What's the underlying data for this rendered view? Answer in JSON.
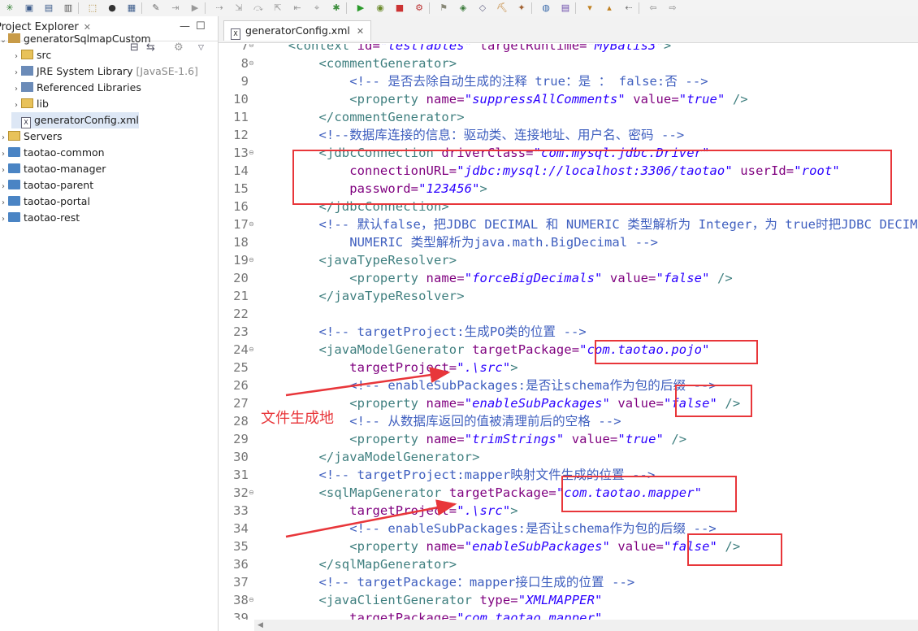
{
  "toolbar": {
    "icons": [
      "new-icon",
      "save-icon",
      "save-all-icon",
      "print-icon",
      "build-icon",
      "user-icon",
      "debug-toggle-icon",
      "pin-icon",
      "skip-icon",
      "run-last-icon",
      "step-icon",
      "step-into-icon",
      "step-over-icon",
      "step-return-icon",
      "drop-frame-icon",
      "use-step-filters-icon",
      "debug-icon",
      "run-icon",
      "coverage-icon",
      "stop-icon",
      "external-tools-icon",
      "new-server-icon",
      "new-class-icon",
      "open-type-icon",
      "open-task-icon",
      "search-icon",
      "globe-icon",
      "tasks-icon",
      "next-annotation-icon",
      "prev-annotation-icon",
      "last-edit-icon",
      "back-icon",
      "forward-icon"
    ]
  },
  "explorer": {
    "title": "Project Explorer",
    "close_glyph": "✕",
    "minimize_glyph": "—",
    "maximize_glyph": "☐",
    "tree": [
      {
        "name": "generatorSqlmapCustom",
        "arrow": "⌄",
        "icon": "project-icon"
      },
      {
        "name": "src",
        "arrow": "›",
        "icon": "package-folder-icon"
      },
      {
        "name": "JRE System Library",
        "suffix": "[JavaSE-1.6]",
        "arrow": "›",
        "icon": "library-icon"
      },
      {
        "name": "Referenced Libraries",
        "arrow": "›",
        "icon": "library-icon"
      },
      {
        "name": "lib",
        "arrow": "›",
        "icon": "folder-icon"
      },
      {
        "name": "generatorConfig.xml",
        "arrow": "",
        "icon": "xml-file-icon"
      },
      {
        "name": "Servers",
        "arrow": "›",
        "icon": "folder-icon"
      },
      {
        "name": "taotao-common",
        "arrow": "›",
        "icon": "project-folder-icon"
      },
      {
        "name": "taotao-manager",
        "arrow": "›",
        "icon": "project-folder-icon"
      },
      {
        "name": "taotao-parent",
        "arrow": "›",
        "icon": "project-folder-icon"
      },
      {
        "name": "taotao-portal",
        "arrow": "›",
        "icon": "project-folder-icon"
      },
      {
        "name": "taotao-rest",
        "arrow": "›",
        "icon": "project-folder-icon"
      }
    ]
  },
  "editor": {
    "tab_label": "generatorConfig.xml",
    "tab_close": "✕",
    "xml_icon_letter": "X",
    "fold_glyph": "⊖",
    "lines": [
      {
        "n": "7",
        "fold": true,
        "t": [
          [
            "    ",
            ""
          ],
          [
            "<context ",
            "tag"
          ],
          [
            "id=",
            "attr"
          ],
          [
            "\"testTables\"",
            "val"
          ],
          [
            " targetRuntime=",
            "attr"
          ],
          [
            "\"MyBatis3\"",
            "val"
          ],
          [
            ">",
            "tag"
          ]
        ]
      },
      {
        "n": "8",
        "fold": true,
        "t": [
          [
            "        ",
            ""
          ],
          [
            "<commentGenerator>",
            "tag"
          ]
        ]
      },
      {
        "n": "9",
        "fold": false,
        "t": [
          [
            "            ",
            ""
          ],
          [
            "<!-- 是否去除自动生成的注释 true：是 ： false:否 -->",
            "cmt"
          ]
        ]
      },
      {
        "n": "10",
        "fold": false,
        "t": [
          [
            "            ",
            ""
          ],
          [
            "<property ",
            "tag"
          ],
          [
            "name=",
            "attr"
          ],
          [
            "\"suppressAllComments\"",
            "val"
          ],
          [
            " value=",
            "attr"
          ],
          [
            "\"true\"",
            "val"
          ],
          [
            " />",
            "tag"
          ]
        ]
      },
      {
        "n": "11",
        "fold": false,
        "t": [
          [
            "        ",
            ""
          ],
          [
            "</commentGenerator>",
            "tag"
          ]
        ]
      },
      {
        "n": "12",
        "fold": false,
        "t": [
          [
            "        ",
            ""
          ],
          [
            "<!--数据库连接的信息：驱动类、连接地址、用户名、密码 -->",
            "cmt"
          ]
        ]
      },
      {
        "n": "13",
        "fold": true,
        "t": [
          [
            "        ",
            ""
          ],
          [
            "<jdbcConnection ",
            "tag"
          ],
          [
            "driverClass=",
            "attr"
          ],
          [
            "\"com.mysql.jdbc.Driver\"",
            "val"
          ]
        ]
      },
      {
        "n": "14",
        "fold": false,
        "t": [
          [
            "            ",
            ""
          ],
          [
            "connectionURL=",
            "attr"
          ],
          [
            "\"jdbc:mysql://localhost:3306/taotao\"",
            "val"
          ],
          [
            " userId=",
            "attr"
          ],
          [
            "\"root\"",
            "val"
          ]
        ]
      },
      {
        "n": "15",
        "fold": false,
        "t": [
          [
            "            ",
            ""
          ],
          [
            "password=",
            "attr"
          ],
          [
            "\"123456\"",
            "val"
          ],
          [
            ">",
            "tag"
          ]
        ]
      },
      {
        "n": "16",
        "fold": false,
        "t": [
          [
            "        ",
            ""
          ],
          [
            "</jdbcConnection>",
            "tag"
          ]
        ]
      },
      {
        "n": "17",
        "fold": true,
        "t": [
          [
            "        ",
            ""
          ],
          [
            "<!-- 默认false，把JDBC DECIMAL 和 NUMERIC 类型解析为 Integer，为 true时把JDBC DECIMAL 和",
            "cmt"
          ]
        ]
      },
      {
        "n": "18",
        "fold": false,
        "t": [
          [
            "            ",
            ""
          ],
          [
            "NUMERIC 类型解析为java.math.BigDecimal -->",
            "cmt"
          ]
        ]
      },
      {
        "n": "19",
        "fold": true,
        "t": [
          [
            "        ",
            ""
          ],
          [
            "<javaTypeResolver>",
            "tag"
          ]
        ]
      },
      {
        "n": "20",
        "fold": false,
        "t": [
          [
            "            ",
            ""
          ],
          [
            "<property ",
            "tag"
          ],
          [
            "name=",
            "attr"
          ],
          [
            "\"forceBigDecimals\"",
            "val"
          ],
          [
            " value=",
            "attr"
          ],
          [
            "\"false\"",
            "val"
          ],
          [
            " />",
            "tag"
          ]
        ]
      },
      {
        "n": "21",
        "fold": false,
        "t": [
          [
            "        ",
            ""
          ],
          [
            "</javaTypeResolver>",
            "tag"
          ]
        ]
      },
      {
        "n": "22",
        "fold": false,
        "t": []
      },
      {
        "n": "23",
        "fold": false,
        "t": [
          [
            "        ",
            ""
          ],
          [
            "<!-- targetProject:生成PO类的位置 -->",
            "cmt"
          ]
        ]
      },
      {
        "n": "24",
        "fold": true,
        "t": [
          [
            "        ",
            ""
          ],
          [
            "<javaModelGenerator ",
            "tag"
          ],
          [
            "targetPackage=",
            "attr"
          ],
          [
            "\"com.taotao.pojo\"",
            "val"
          ]
        ]
      },
      {
        "n": "25",
        "fold": false,
        "t": [
          [
            "            ",
            ""
          ],
          [
            "targetProject=",
            "attr"
          ],
          [
            "\".\\src\"",
            "val"
          ],
          [
            ">",
            "tag"
          ]
        ]
      },
      {
        "n": "26",
        "fold": false,
        "t": [
          [
            "            ",
            ""
          ],
          [
            "<!-- enableSubPackages:是否让schema作为包的后缀 -->",
            "cmt"
          ]
        ]
      },
      {
        "n": "27",
        "fold": false,
        "t": [
          [
            "            ",
            ""
          ],
          [
            "<property ",
            "tag"
          ],
          [
            "name=",
            "attr"
          ],
          [
            "\"enableSubPackages\"",
            "val"
          ],
          [
            " value=",
            "attr"
          ],
          [
            "\"false\"",
            "val"
          ],
          [
            " />",
            "tag"
          ]
        ]
      },
      {
        "n": "28",
        "fold": false,
        "t": [
          [
            "            ",
            ""
          ],
          [
            "<!-- 从数据库返回的值被清理前后的空格 -->",
            "cmt"
          ]
        ]
      },
      {
        "n": "29",
        "fold": false,
        "t": [
          [
            "            ",
            ""
          ],
          [
            "<property ",
            "tag"
          ],
          [
            "name=",
            "attr"
          ],
          [
            "\"trimStrings\"",
            "val"
          ],
          [
            " value=",
            "attr"
          ],
          [
            "\"true\"",
            "val"
          ],
          [
            " />",
            "tag"
          ]
        ]
      },
      {
        "n": "30",
        "fold": false,
        "t": [
          [
            "        ",
            ""
          ],
          [
            "</javaModelGenerator>",
            "tag"
          ]
        ]
      },
      {
        "n": "31",
        "fold": false,
        "t": [
          [
            "        ",
            ""
          ],
          [
            "<!-- targetProject:mapper映射文件生成的位置 -->",
            "cmt"
          ]
        ]
      },
      {
        "n": "32",
        "fold": true,
        "t": [
          [
            "        ",
            ""
          ],
          [
            "<sqlMapGenerator ",
            "tag"
          ],
          [
            "targetPackage=",
            "attr"
          ],
          [
            "\"com.taotao.mapper\"",
            "val"
          ]
        ]
      },
      {
        "n": "33",
        "fold": false,
        "t": [
          [
            "            ",
            ""
          ],
          [
            "targetProject=",
            "attr"
          ],
          [
            "\".\\src\"",
            "val"
          ],
          [
            ">",
            "tag"
          ]
        ]
      },
      {
        "n": "34",
        "fold": false,
        "t": [
          [
            "            ",
            ""
          ],
          [
            "<!-- enableSubPackages:是否让schema作为包的后缀 -->",
            "cmt"
          ]
        ]
      },
      {
        "n": "35",
        "fold": false,
        "t": [
          [
            "            ",
            ""
          ],
          [
            "<property ",
            "tag"
          ],
          [
            "name=",
            "attr"
          ],
          [
            "\"enableSubPackages\"",
            "val"
          ],
          [
            " value=",
            "attr"
          ],
          [
            "\"false\"",
            "val"
          ],
          [
            " />",
            "tag"
          ]
        ]
      },
      {
        "n": "36",
        "fold": false,
        "t": [
          [
            "        ",
            ""
          ],
          [
            "</sqlMapGenerator>",
            "tag"
          ]
        ]
      },
      {
        "n": "37",
        "fold": false,
        "t": [
          [
            "        ",
            ""
          ],
          [
            "<!-- targetPackage：mapper接口生成的位置 -->",
            "cmt"
          ]
        ]
      },
      {
        "n": "38",
        "fold": true,
        "t": [
          [
            "        ",
            ""
          ],
          [
            "<javaClientGenerator ",
            "tag"
          ],
          [
            "type=",
            "attr"
          ],
          [
            "\"XMLMAPPER\"",
            "val"
          ]
        ]
      },
      {
        "n": "39",
        "fold": false,
        "t": [
          [
            "            ",
            ""
          ],
          [
            "targetPackage=",
            "attr"
          ],
          [
            "\"com.taotao.mapper\"",
            "val"
          ]
        ]
      }
    ]
  },
  "annotations": {
    "label": "文件生成地",
    "color": "#e8363a"
  },
  "colors": {
    "tag": "#3f7f7f",
    "attr": "#7f007f",
    "value": "#2a00ff",
    "comment": "#3f5fbf",
    "selection": "#dde7f5"
  }
}
